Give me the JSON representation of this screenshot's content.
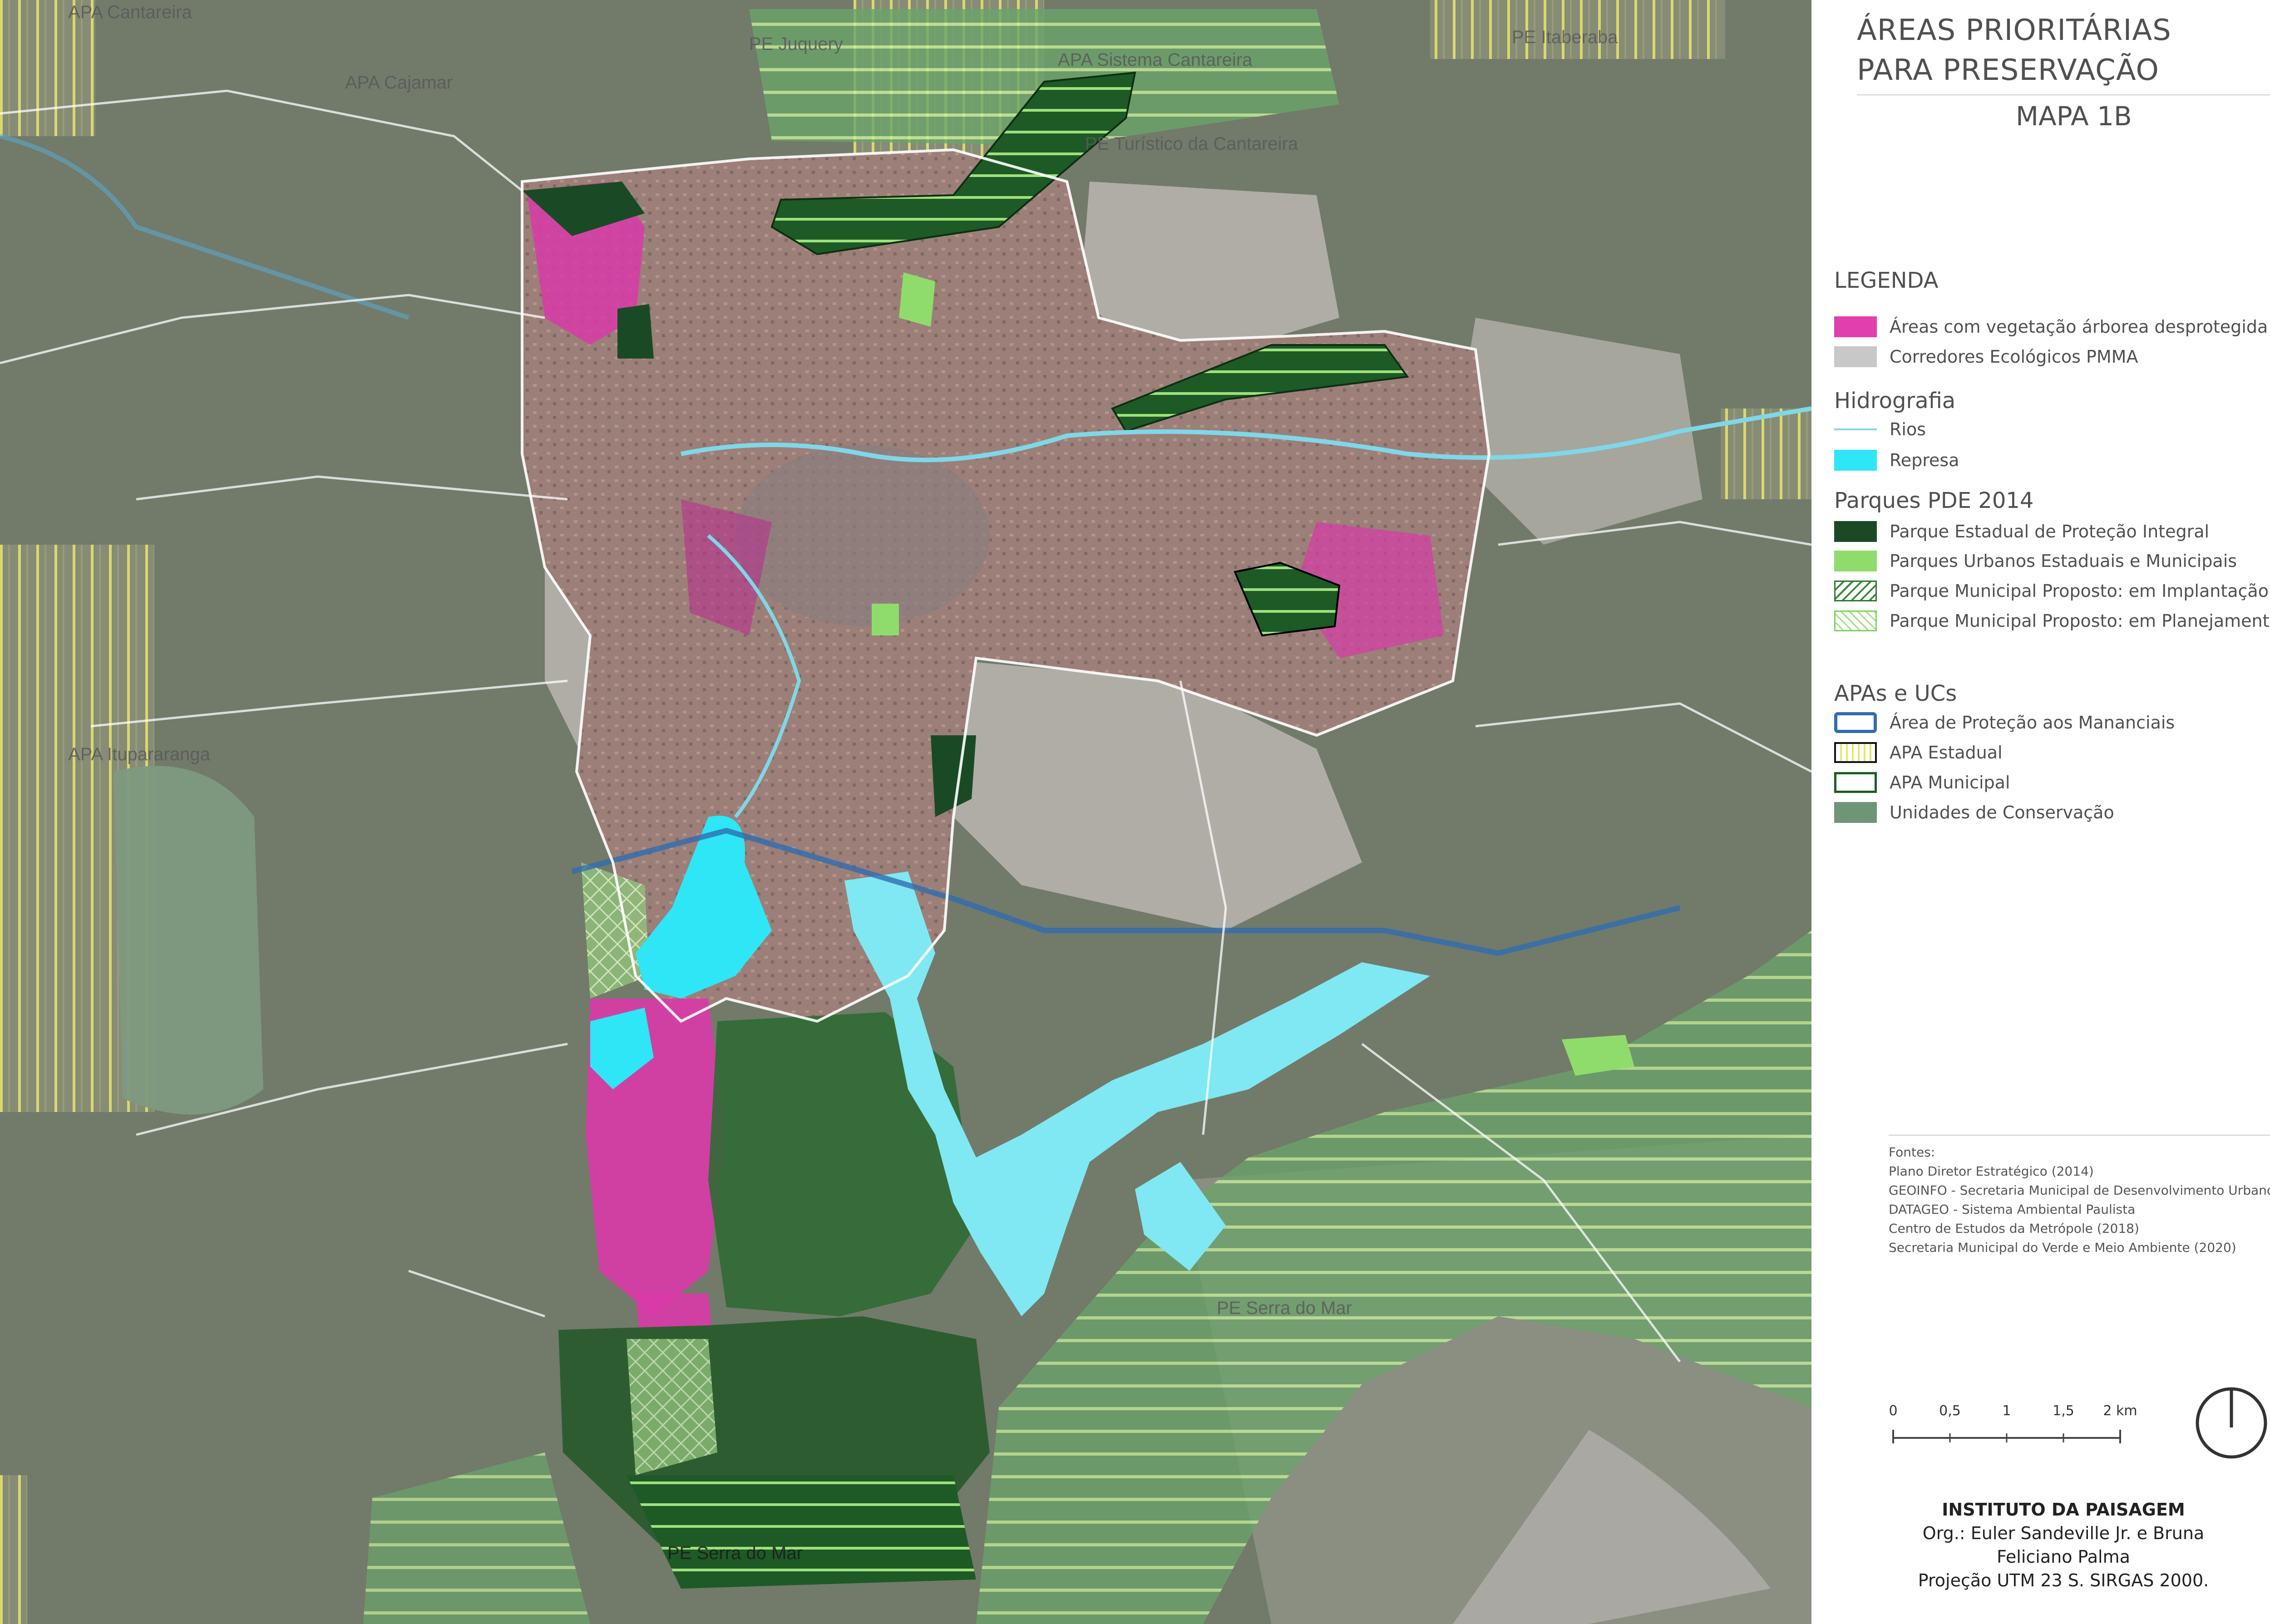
{
  "title": {
    "line1": "ÁREAS PRIORITÁRIAS",
    "line2": "PARA PRESERVAÇÃO",
    "subtitle": "MAPA 1B"
  },
  "legend": {
    "heading": "LEGENDA",
    "items": [
      {
        "label": "Áreas com vegetação árborea desprotegida",
        "color": "#e23fae"
      },
      {
        "label": "Corredores Ecológicos PMMA",
        "color": "#c8c8c8"
      }
    ],
    "hydro_heading": "Hidrografia",
    "hydro": [
      {
        "label": "Rios",
        "color": "#7fd7e8"
      },
      {
        "label": "Represa",
        "color": "#2ee6f5"
      }
    ],
    "parks_heading": "Parques PDE 2014",
    "parks": [
      {
        "label": "Parque Estadual de Proteção Integral",
        "color": "#1a4a25"
      },
      {
        "label": "Parques Urbanos Estaduais e Municipais",
        "color": "#8fdc6c"
      },
      {
        "label": "Parque Municipal Proposto: em Implantação",
        "color": "#3a8a3a"
      },
      {
        "label": "Parque Municipal Proposto: em Planejamento",
        "color": "#9be07a"
      }
    ],
    "apa_heading": "APAs e UCs",
    "apas": [
      {
        "label": "Área de Proteção aos Mananciais",
        "color": "#2f6db0"
      },
      {
        "label": "APA Estadual",
        "color": "#e8e66a"
      },
      {
        "label": "APA Municipal",
        "color": "#1c5d22"
      },
      {
        "label": "Unidades de Conservação",
        "color": "#6e9676"
      }
    ]
  },
  "sources": {
    "heading": "Fontes:",
    "lines": [
      "Plano Diretor Estratégico (2014)",
      "GEOINFO - Secretaria Municipal de Desenvolvimento Urbano",
      "DATAGEO - Sistema Ambiental Paulista",
      "Centro de Estudos da Metrópole (2018)",
      "Secretaria Municipal do Verde e Meio Ambiente (2020)"
    ]
  },
  "scale": {
    "ticks": [
      "0",
      "0,5",
      "1",
      "1,5",
      "2 km"
    ]
  },
  "credits": {
    "institution": "INSTITUTO DA PAISAGEM",
    "org": "Org.: Euler Sandeville Jr. e Bruna",
    "org2": "Feliciano Palma",
    "projection": "Projeção UTM 23 S. SIRGAS 2000."
  },
  "map_labels": {
    "apa_cantareira": "APA Cantareira",
    "pe_juquery": "PE Juquery",
    "apa_cajamar": "APA Cajamar",
    "apa_sistema_cantareira": "APA Sistema Cantareira",
    "pe_itaberaba": "PE Itaberaba",
    "pe_cantareira": "PE Turístico da Cantareira",
    "apa_itupararanga": "APA Itupararanga",
    "pe_serra_do_mar_east": "PE Serra do Mar",
    "pe_serra_do_mar_south": "PE Serra do Mar"
  }
}
